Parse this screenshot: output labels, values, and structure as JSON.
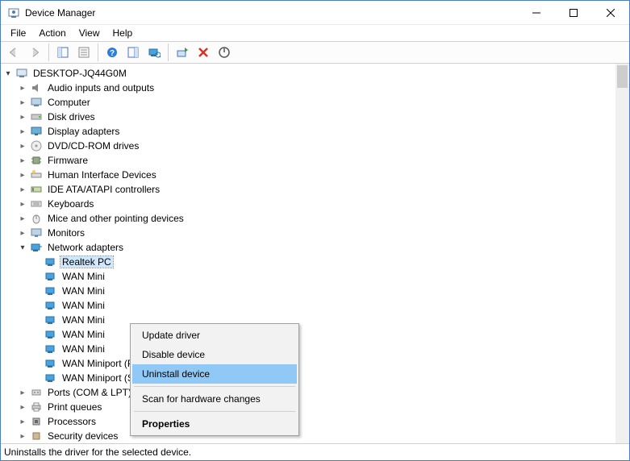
{
  "window": {
    "title": "Device Manager"
  },
  "menubar": {
    "file": "File",
    "action": "Action",
    "view": "View",
    "help": "Help"
  },
  "tree": {
    "root": "DESKTOP-JQ44G0M",
    "cats": {
      "audio": "Audio inputs and outputs",
      "computer": "Computer",
      "disk": "Disk drives",
      "display": "Display adapters",
      "dvd": "DVD/CD-ROM drives",
      "firmware": "Firmware",
      "hid": "Human Interface Devices",
      "ide": "IDE ATA/ATAPI controllers",
      "keyboards": "Keyboards",
      "mice": "Mice and other pointing devices",
      "monitors": "Monitors",
      "network": "Network adapters",
      "ports": "Ports (COM & LPT)",
      "printq": "Print queues",
      "processors": "Processors",
      "security": "Security devices"
    },
    "network_children": {
      "realtek": "Realtek PC",
      "wan1": "WAN Mini",
      "wan2": "WAN Mini",
      "wan3": "WAN Mini",
      "wan4": "WAN Mini",
      "wan5": "WAN Mini",
      "wan6": "WAN Mini",
      "wan_pptp": "WAN Miniport (PPTP)",
      "wan_sstp": "WAN Miniport (SSTP)"
    }
  },
  "contextmenu": {
    "update": "Update driver",
    "disable": "Disable device",
    "uninstall": "Uninstall device",
    "scan": "Scan for hardware changes",
    "properties": "Properties"
  },
  "statusbar": {
    "text": "Uninstalls the driver for the selected device."
  }
}
